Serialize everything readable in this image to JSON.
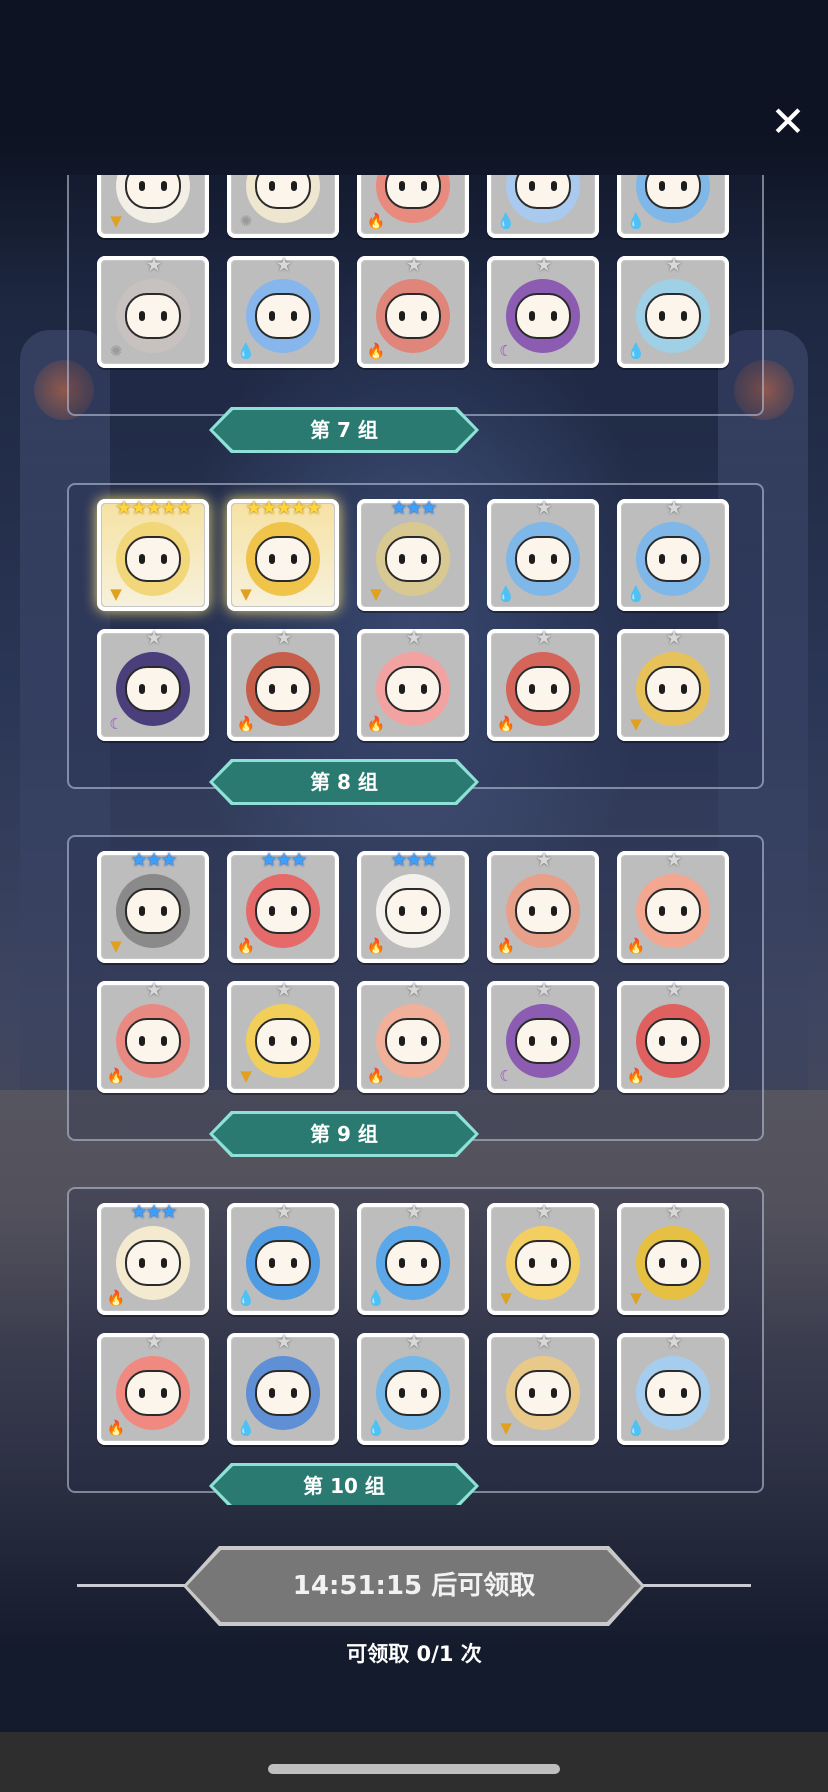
{
  "close_icon": "close-icon",
  "groups": [
    {
      "label": "第 7 组",
      "cards": [
        {
          "stars": "grey",
          "count": 0,
          "element": "earth",
          "hue": "#f3efe6"
        },
        {
          "stars": "grey",
          "count": 0,
          "element": "light",
          "hue": "#efe6cf"
        },
        {
          "stars": "grey",
          "count": 0,
          "element": "fire",
          "hue": "#e98a7e"
        },
        {
          "stars": "grey",
          "count": 0,
          "element": "water",
          "hue": "#a9c9ee"
        },
        {
          "stars": "grey",
          "count": 0,
          "element": "water",
          "hue": "#7fb8e8"
        },
        {
          "stars": "grey",
          "count": 1,
          "element": "light",
          "hue": "#c7c2c0"
        },
        {
          "stars": "grey",
          "count": 1,
          "element": "water",
          "hue": "#86b6ec"
        },
        {
          "stars": "grey",
          "count": 1,
          "element": "fire",
          "hue": "#e0857a"
        },
        {
          "stars": "grey",
          "count": 1,
          "element": "dark",
          "hue": "#8c5bb2"
        },
        {
          "stars": "grey",
          "count": 1,
          "element": "water",
          "hue": "#9fd0e6"
        }
      ]
    },
    {
      "label": "第 8 组",
      "cards": [
        {
          "stars": "gold",
          "count": 5,
          "element": "earth",
          "hue": "#f1d77a",
          "gold": true
        },
        {
          "stars": "gold",
          "count": 5,
          "element": "earth",
          "hue": "#f0c44a",
          "gold": true
        },
        {
          "stars": "blue",
          "count": 3,
          "element": "earth",
          "hue": "#d8c892"
        },
        {
          "stars": "grey",
          "count": 1,
          "element": "water",
          "hue": "#7fb8e8"
        },
        {
          "stars": "grey",
          "count": 1,
          "element": "water",
          "hue": "#7fb8e8"
        },
        {
          "stars": "grey",
          "count": 1,
          "element": "dark",
          "hue": "#4a3f7a"
        },
        {
          "stars": "grey",
          "count": 1,
          "element": "fire",
          "hue": "#c75e4a"
        },
        {
          "stars": "grey",
          "count": 1,
          "element": "fire",
          "hue": "#f3a2a2"
        },
        {
          "stars": "grey",
          "count": 1,
          "element": "fire",
          "hue": "#d5655a"
        },
        {
          "stars": "grey",
          "count": 1,
          "element": "earth",
          "hue": "#e7c15a"
        }
      ]
    },
    {
      "label": "第 9 组",
      "cards": [
        {
          "stars": "blue",
          "count": 3,
          "element": "earth",
          "hue": "#8a8a8a"
        },
        {
          "stars": "blue",
          "count": 3,
          "element": "fire",
          "hue": "#e66a6a"
        },
        {
          "stars": "blue",
          "count": 3,
          "element": "fire",
          "hue": "#f4f0ec"
        },
        {
          "stars": "grey",
          "count": 1,
          "element": "fire",
          "hue": "#e9a08a"
        },
        {
          "stars": "grey",
          "count": 1,
          "element": "fire",
          "hue": "#f3a690"
        },
        {
          "stars": "grey",
          "count": 1,
          "element": "fire",
          "hue": "#e88a82"
        },
        {
          "stars": "grey",
          "count": 1,
          "element": "earth",
          "hue": "#f1cf5a"
        },
        {
          "stars": "grey",
          "count": 1,
          "element": "fire",
          "hue": "#f0b09a"
        },
        {
          "stars": "grey",
          "count": 1,
          "element": "dark",
          "hue": "#8c5bb2"
        },
        {
          "stars": "grey",
          "count": 1,
          "element": "fire",
          "hue": "#e06060"
        }
      ]
    },
    {
      "label": "第 10 组",
      "cards": [
        {
          "stars": "blue",
          "count": 3,
          "element": "fire",
          "hue": "#f4ead0"
        },
        {
          "stars": "grey",
          "count": 1,
          "element": "water",
          "hue": "#4f9be4"
        },
        {
          "stars": "grey",
          "count": 1,
          "element": "water",
          "hue": "#5aa8ea"
        },
        {
          "stars": "grey",
          "count": 1,
          "element": "earth",
          "hue": "#f3cf62"
        },
        {
          "stars": "grey",
          "count": 1,
          "element": "earth",
          "hue": "#e6c042"
        },
        {
          "stars": "grey",
          "count": 1,
          "element": "fire",
          "hue": "#f08a80"
        },
        {
          "stars": "grey",
          "count": 1,
          "element": "water",
          "hue": "#5f8fd4"
        },
        {
          "stars": "grey",
          "count": 1,
          "element": "water",
          "hue": "#73b8e8"
        },
        {
          "stars": "grey",
          "count": 1,
          "element": "earth",
          "hue": "#e9c98a"
        },
        {
          "stars": "grey",
          "count": 1,
          "element": "water",
          "hue": "#a6cdee"
        }
      ]
    }
  ],
  "timer_button": "14:51:15 后可领取",
  "claim_count": "可领取 0/1 次",
  "colors": {
    "ribbon": "#2a7a72",
    "ribbon_edge": "#8fe0d6",
    "button": "#777777"
  }
}
